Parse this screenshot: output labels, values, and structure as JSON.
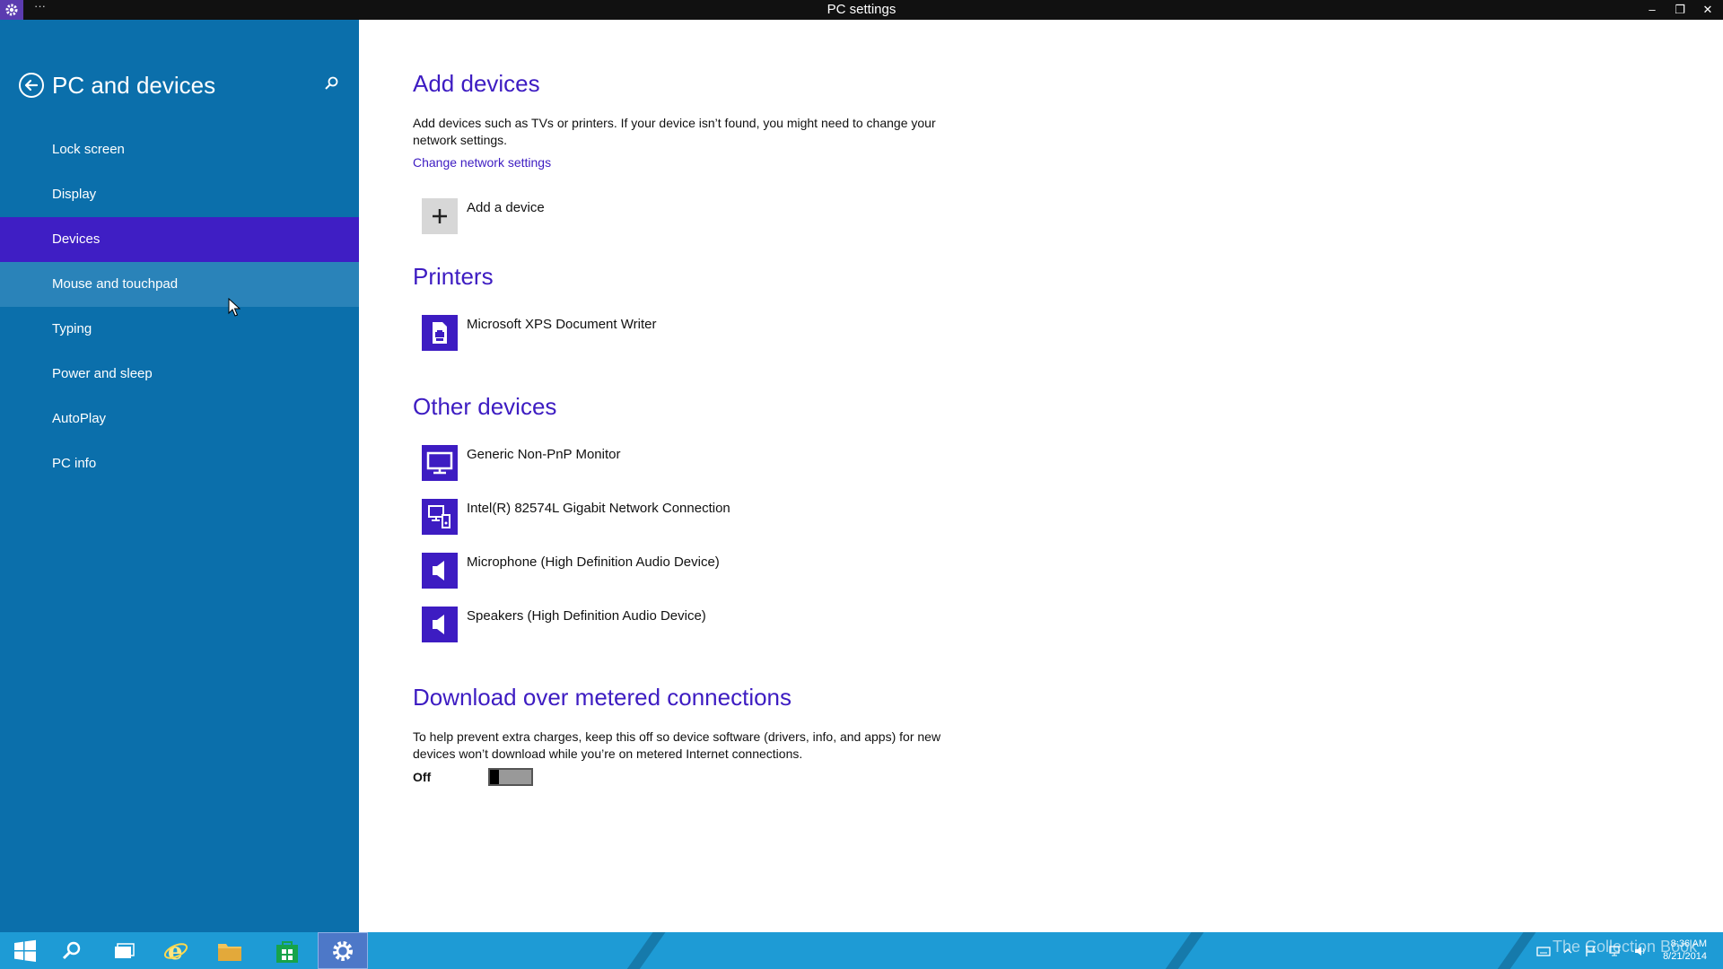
{
  "window": {
    "title": "PC settings",
    "dots": "···",
    "minimize": "–",
    "restore": "❐",
    "close": "✕"
  },
  "sidebar": {
    "title": "PC and devices",
    "items": [
      {
        "label": "Lock screen",
        "state": "normal"
      },
      {
        "label": "Display",
        "state": "normal"
      },
      {
        "label": "Devices",
        "state": "selected"
      },
      {
        "label": "Mouse and touchpad",
        "state": "hover"
      },
      {
        "label": "Typing",
        "state": "normal"
      },
      {
        "label": "Power and sleep",
        "state": "normal"
      },
      {
        "label": "AutoPlay",
        "state": "normal"
      },
      {
        "label": "PC info",
        "state": "normal"
      }
    ]
  },
  "main": {
    "add_devices": {
      "heading": "Add devices",
      "description": "Add devices such as TVs or printers. If your device isn’t found, you might need to change your network settings.",
      "link": "Change network settings",
      "add_label": "Add a device"
    },
    "printers": {
      "heading": "Printers",
      "items": [
        {
          "label": "Microsoft XPS Document Writer",
          "icon": "printer-icon"
        }
      ]
    },
    "other_devices": {
      "heading": "Other devices",
      "items": [
        {
          "label": "Generic Non-PnP Monitor",
          "icon": "monitor-icon"
        },
        {
          "label": "Intel(R) 82574L Gigabit Network Connection",
          "icon": "network-icon"
        },
        {
          "label": "Microphone (High Definition Audio Device)",
          "icon": "speaker-icon"
        },
        {
          "label": "Speakers (High Definition Audio Device)",
          "icon": "speaker-icon"
        }
      ]
    },
    "metered": {
      "heading": "Download over metered connections",
      "description": "To help prevent extra charges, keep this off so device software (drivers, info, and apps) for new devices won’t download while you’re on metered Internet connections.",
      "toggle_label": "Off",
      "toggle_state": "off"
    }
  },
  "taskbar": {
    "time": "8:36 AM",
    "date": "8/21/2014",
    "watermark": "The Collection Book",
    "colors": {
      "accent": "#3d1cc2",
      "sidebar": "#0b6fab",
      "taskbar": "#1e9bd5"
    }
  }
}
